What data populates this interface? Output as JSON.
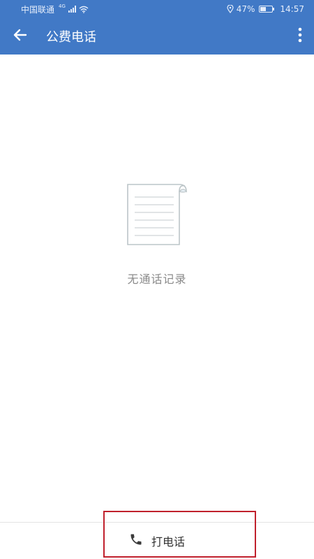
{
  "status_bar": {
    "carrier": "中国联通",
    "network": "4G",
    "battery": "47%",
    "battery_level": 0.47,
    "time": "14:57"
  },
  "app_bar": {
    "title": "公费电话",
    "back_icon": "arrow-left-icon",
    "more_icon": "more-vertical-icon"
  },
  "empty_state": {
    "icon": "document-icon",
    "text": "无通话记录"
  },
  "bottom_bar": {
    "call_icon": "phone-icon",
    "call_label": "打电话"
  },
  "colors": {
    "primary": "#4179c6",
    "highlight": "#c0202c",
    "muted_text": "#8a8a8a"
  }
}
